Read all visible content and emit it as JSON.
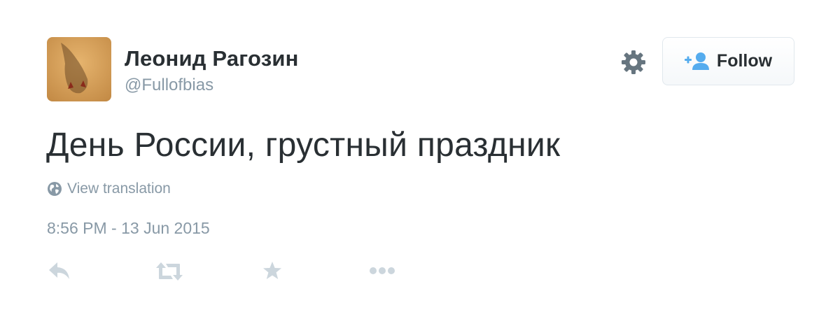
{
  "tweet": {
    "author": {
      "display_name": "Леонид Рагозин",
      "handle": "@Fullofbias",
      "avatar_icon": "avatar-photo"
    },
    "text": "День России, грустный праздник",
    "view_translation_label": "View translation",
    "timestamp": "8:56 PM - 13 Jun 2015",
    "follow_button_label": "Follow",
    "icons": {
      "settings": "gear-icon",
      "follow": "add-user-icon",
      "translation": "globe-icon",
      "reply": "reply-icon",
      "retweet": "retweet-icon",
      "favorite": "star-icon",
      "more": "more-icon"
    }
  },
  "colors": {
    "text_primary": "#292f33",
    "text_secondary": "#8899a6",
    "action_icons": "#ccd6dd",
    "accent": "#55acee",
    "gear": "#66757f"
  }
}
